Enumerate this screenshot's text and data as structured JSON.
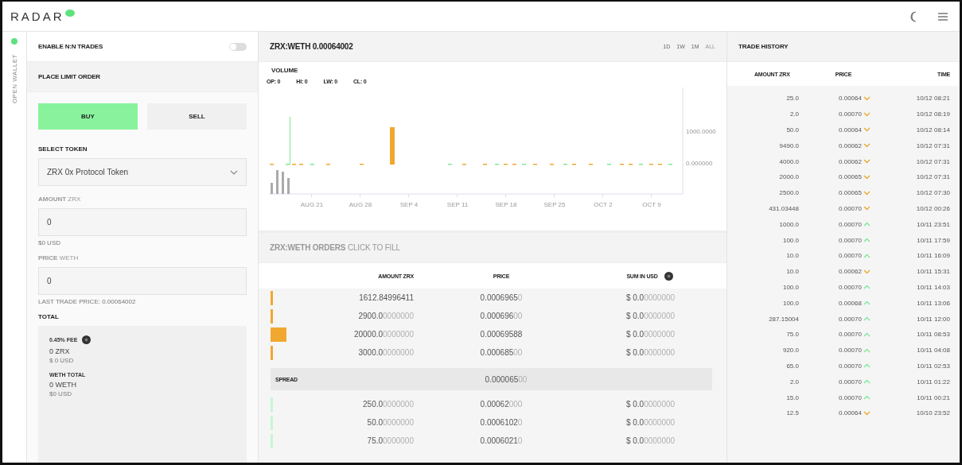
{
  "header": {
    "logo": "RADAR"
  },
  "side_tab": {
    "label": "OPEN WALLET",
    "connected": true
  },
  "order_form": {
    "toggle": {
      "label": "ENABLE N:N TRADES",
      "on": false
    },
    "title": "PLACE LIMIT ORDER",
    "sides": [
      {
        "label": "BUY",
        "selected": true
      },
      {
        "label": "SELL",
        "selected": false
      }
    ],
    "token": {
      "label": "SELECT TOKEN",
      "value": "ZRX  0x Protocol Token"
    },
    "amount": {
      "label": "**AMOUNT** ZRX",
      "value": "0",
      "note": "$0 USD"
    },
    "price": {
      "label": "**PRICE** WETH",
      "value": "0",
      "note": "LAST TRADE PRICE: 0.00064002"
    },
    "total": {
      "label": "TOTAL",
      "fee_label": "0.45% FEE",
      "fee": "0 ZRX",
      "fee_usd": "$ 0 USD",
      "weth_label": "WETH TOTAL",
      "weth": "0 WETH",
      "weth_usd": "$0 USD"
    }
  },
  "chart_panel": {
    "title": "ZRX:WETH 0.00064002",
    "ranges": [
      {
        "label": "1D",
        "selected": false
      },
      {
        "label": "1W",
        "selected": false
      },
      {
        "label": "1M",
        "selected": false
      },
      {
        "label": "ALL",
        "selected": true
      }
    ],
    "volume_label": "VOLUME",
    "ohlc": [
      "OP: 0",
      "HI: 0",
      "LW: 0",
      "CL: 0"
    ],
    "y_ticks": [
      "1000.0000",
      "0.000000"
    ],
    "x_ticks": [
      "AUG 21",
      "AUG 28",
      "SEP 4",
      "SEP 11",
      "SEP 18",
      "SEP 25",
      "OCT 2",
      "OCT 9"
    ]
  },
  "orders": {
    "title": "**ZRX:WETH ORDERS** CLICK TO FILL",
    "columns": [
      "AMOUNT ZRX",
      "PRICE",
      "SUM IN USD"
    ],
    "asks": [
      {
        "amount": "1612.84996411",
        "price": "0.0006965",
        "price_pad": "0",
        "sum": "$ 0.0",
        "sum_pad": "0000000",
        "kind": "thin"
      },
      {
        "amount": "2900.0",
        "amount_pad": "0000000",
        "price": "0.000696",
        "price_pad": "00",
        "sum": "$ 0.0",
        "sum_pad": "0000000",
        "kind": "thin"
      },
      {
        "amount": "20000.0",
        "amount_pad": "0000000",
        "price": "0.00069588",
        "sum": "$ 0.0",
        "sum_pad": "0000000",
        "kind": "wide"
      },
      {
        "amount": "3000.0",
        "amount_pad": "0000000",
        "price": "0.000685",
        "price_pad": "00",
        "sum": "$ 0.0",
        "sum_pad": "0000000",
        "kind": "thin"
      }
    ],
    "spread": {
      "label": "SPREAD",
      "value": "0.000065",
      "value_pad": "00"
    },
    "bids": [
      {
        "amount": "250.0",
        "amount_pad": "0000000",
        "price": "0.00062",
        "price_pad": "000",
        "sum": "$ 0.0",
        "sum_pad": "0000000",
        "kind": "thin"
      },
      {
        "amount": "50.0",
        "amount_pad": "0000000",
        "price": "0.0006102",
        "price_pad": "0",
        "sum": "$ 0.0",
        "sum_pad": "0000000",
        "kind": "thin"
      },
      {
        "amount": "75.0",
        "amount_pad": "0000000",
        "price": "0.0006021",
        "price_pad": "0",
        "sum": "$ 0.0",
        "sum_pad": "0000000",
        "kind": "thin"
      }
    ]
  },
  "trade_history": {
    "title": "TRADE HISTORY",
    "columns": [
      "AMOUNT ZRX",
      "PRICE",
      "TIME"
    ],
    "rows": [
      {
        "amount": "25.0",
        "price": "0.00064",
        "time": "10/12 08:21",
        "kind": "down"
      },
      {
        "amount": "2.0",
        "price": "0.00070",
        "time": "10/12 08:19",
        "kind": "down"
      },
      {
        "amount": "50.0",
        "price": "0.00064",
        "time": "10/12 08:14",
        "kind": "down"
      },
      {
        "amount": "9490.0",
        "price": "0.00062",
        "time": "10/12 07:31",
        "kind": "down"
      },
      {
        "amount": "4000.0",
        "price": "0.00062",
        "time": "10/12 07:31",
        "kind": "down"
      },
      {
        "amount": "2000.0",
        "price": "0.00065",
        "time": "10/12 07:31",
        "kind": "down"
      },
      {
        "amount": "2500.0",
        "price": "0.00065",
        "time": "10/12 07:30",
        "kind": "down"
      },
      {
        "amount": "431.03448",
        "price": "0.00070",
        "time": "10/12 00:26",
        "kind": "down"
      },
      {
        "amount": "1000.0",
        "price": "0.00070",
        "time": "10/11 23:51",
        "kind": "up"
      },
      {
        "amount": "100.0",
        "price": "0.00070",
        "time": "10/11 17:59",
        "kind": "up"
      },
      {
        "amount": "10.0",
        "price": "0.00070",
        "time": "10/11 16:09",
        "kind": "up"
      },
      {
        "amount": "10.0",
        "price": "0.00062",
        "time": "10/11 15:31",
        "kind": "down"
      },
      {
        "amount": "100.0",
        "price": "0.00070",
        "time": "10/11 14:03",
        "kind": "up"
      },
      {
        "amount": "100.0",
        "price": "0.00068",
        "time": "10/11 13:06",
        "kind": "up"
      },
      {
        "amount": "287.15004",
        "price": "0.00070",
        "time": "10/11 12:00",
        "kind": "up"
      },
      {
        "amount": "75.0",
        "price": "0.00070",
        "time": "10/11 08:53",
        "kind": "up"
      },
      {
        "amount": "920.0",
        "price": "0.00070",
        "time": "10/11 04:08",
        "kind": "up"
      },
      {
        "amount": "65.0",
        "price": "0.00070",
        "time": "10/11 02:53",
        "kind": "up"
      },
      {
        "amount": "2.0",
        "price": "0.00070",
        "time": "10/11 01:22",
        "kind": "up"
      },
      {
        "amount": "15.0",
        "price": "0.00070",
        "time": "10/11 00:21",
        "kind": "up"
      },
      {
        "amount": "12.5",
        "price": "0.00064",
        "time": "10/10 23:52",
        "kind": "down"
      }
    ]
  }
}
